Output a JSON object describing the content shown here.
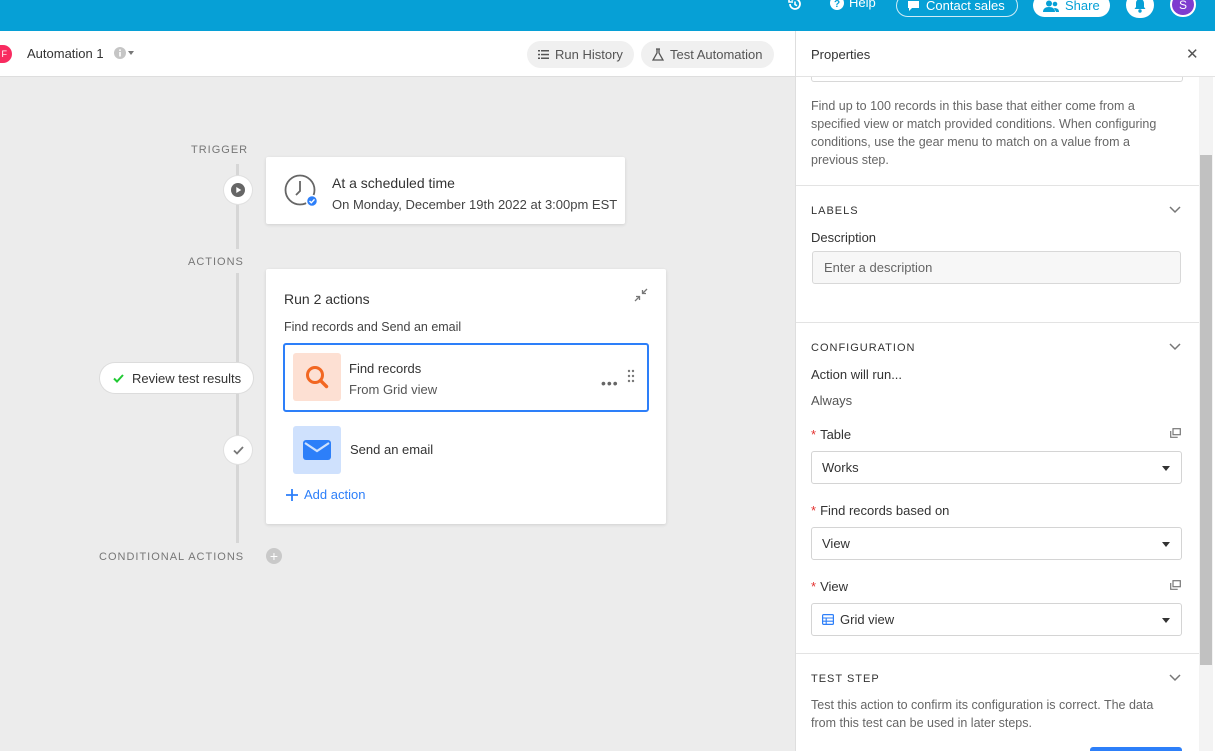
{
  "topbar": {
    "help_label": "Help",
    "contact_label": "Contact sales",
    "share_label": "Share",
    "avatar_initial": "S",
    "bg_color": "#06a0d6"
  },
  "subheader": {
    "base_badge": "F",
    "automation_name": "Automation 1",
    "run_history_label": "Run History",
    "test_automation_label": "Test Automation"
  },
  "canvas": {
    "trigger_label": "TRIGGER",
    "actions_label": "ACTIONS",
    "conditional_label": "CONDITIONAL ACTIONS",
    "trigger_card": {
      "title": "At a scheduled time",
      "subtitle": "On Monday, December 19th 2022 at 3:00pm EST"
    },
    "actions_card": {
      "title": "Run 2 actions",
      "subtitle": "Find records and Send an email",
      "steps": [
        {
          "name": "Find records",
          "sub": "From Grid view",
          "icon": "search-icon",
          "color": "#f26722"
        },
        {
          "name": "Send an email",
          "sub": "",
          "icon": "mail-icon",
          "color": "#2d7ff9"
        }
      ],
      "add_action_label": "Add action"
    },
    "review_label": "Review test results"
  },
  "panel": {
    "title": "Properties",
    "description": "Find up to 100 records in this base that either come from a specified view or match provided conditions. When configuring conditions, use the gear menu to match on a value from a previous step.",
    "labels_section": "LABELS",
    "description_label": "Description",
    "description_placeholder": "Enter a description",
    "config_section": "CONFIGURATION",
    "action_will_run_label": "Action will run...",
    "action_will_run_value": "Always",
    "table_label": "Table",
    "table_value": "Works",
    "find_based_label": "Find records based on",
    "find_based_value": "View",
    "view_label": "View",
    "view_value": "Grid view",
    "test_section": "TEST STEP",
    "test_description": "Test this action to confirm its configuration is correct. The data from this test can be used in later steps."
  }
}
